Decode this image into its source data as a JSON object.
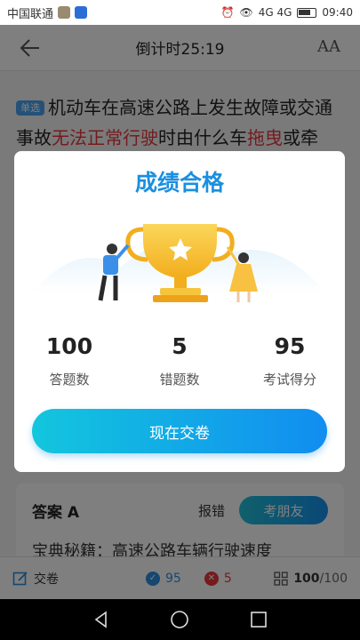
{
  "statusbar": {
    "carrier": "中国联通",
    "network": "4G 4G",
    "time": "09:40"
  },
  "topbar": {
    "title": "倒计时25:19",
    "font_icon": "AA"
  },
  "question": {
    "tag": "单选",
    "text_1": "机动车在高速公路上发生故障或交通事故",
    "text_red_1": "无法正常行驶",
    "text_2": "时由什么车",
    "text_red_2": "拖曳",
    "text_3": "或牵引?"
  },
  "answer": {
    "label": "答案  A",
    "report": "报错",
    "friend_button": "考朋友",
    "tips": "宝典秘籍：高速公路车辆行驶速度"
  },
  "bottombar": {
    "submit": "交卷",
    "correct_count": "95",
    "wrong_count": "5",
    "progress_current": "100",
    "progress_total": "/100"
  },
  "modal": {
    "title": "成绩合格",
    "stats": [
      {
        "value": "100",
        "label": "答题数"
      },
      {
        "value": "5",
        "label": "错题数"
      },
      {
        "value": "95",
        "label": "考试得分"
      }
    ],
    "submit_button": "现在交卷"
  },
  "colors": {
    "accent": "#1a8fe0",
    "red": "#e8373c",
    "trophy": "#f6c233"
  }
}
